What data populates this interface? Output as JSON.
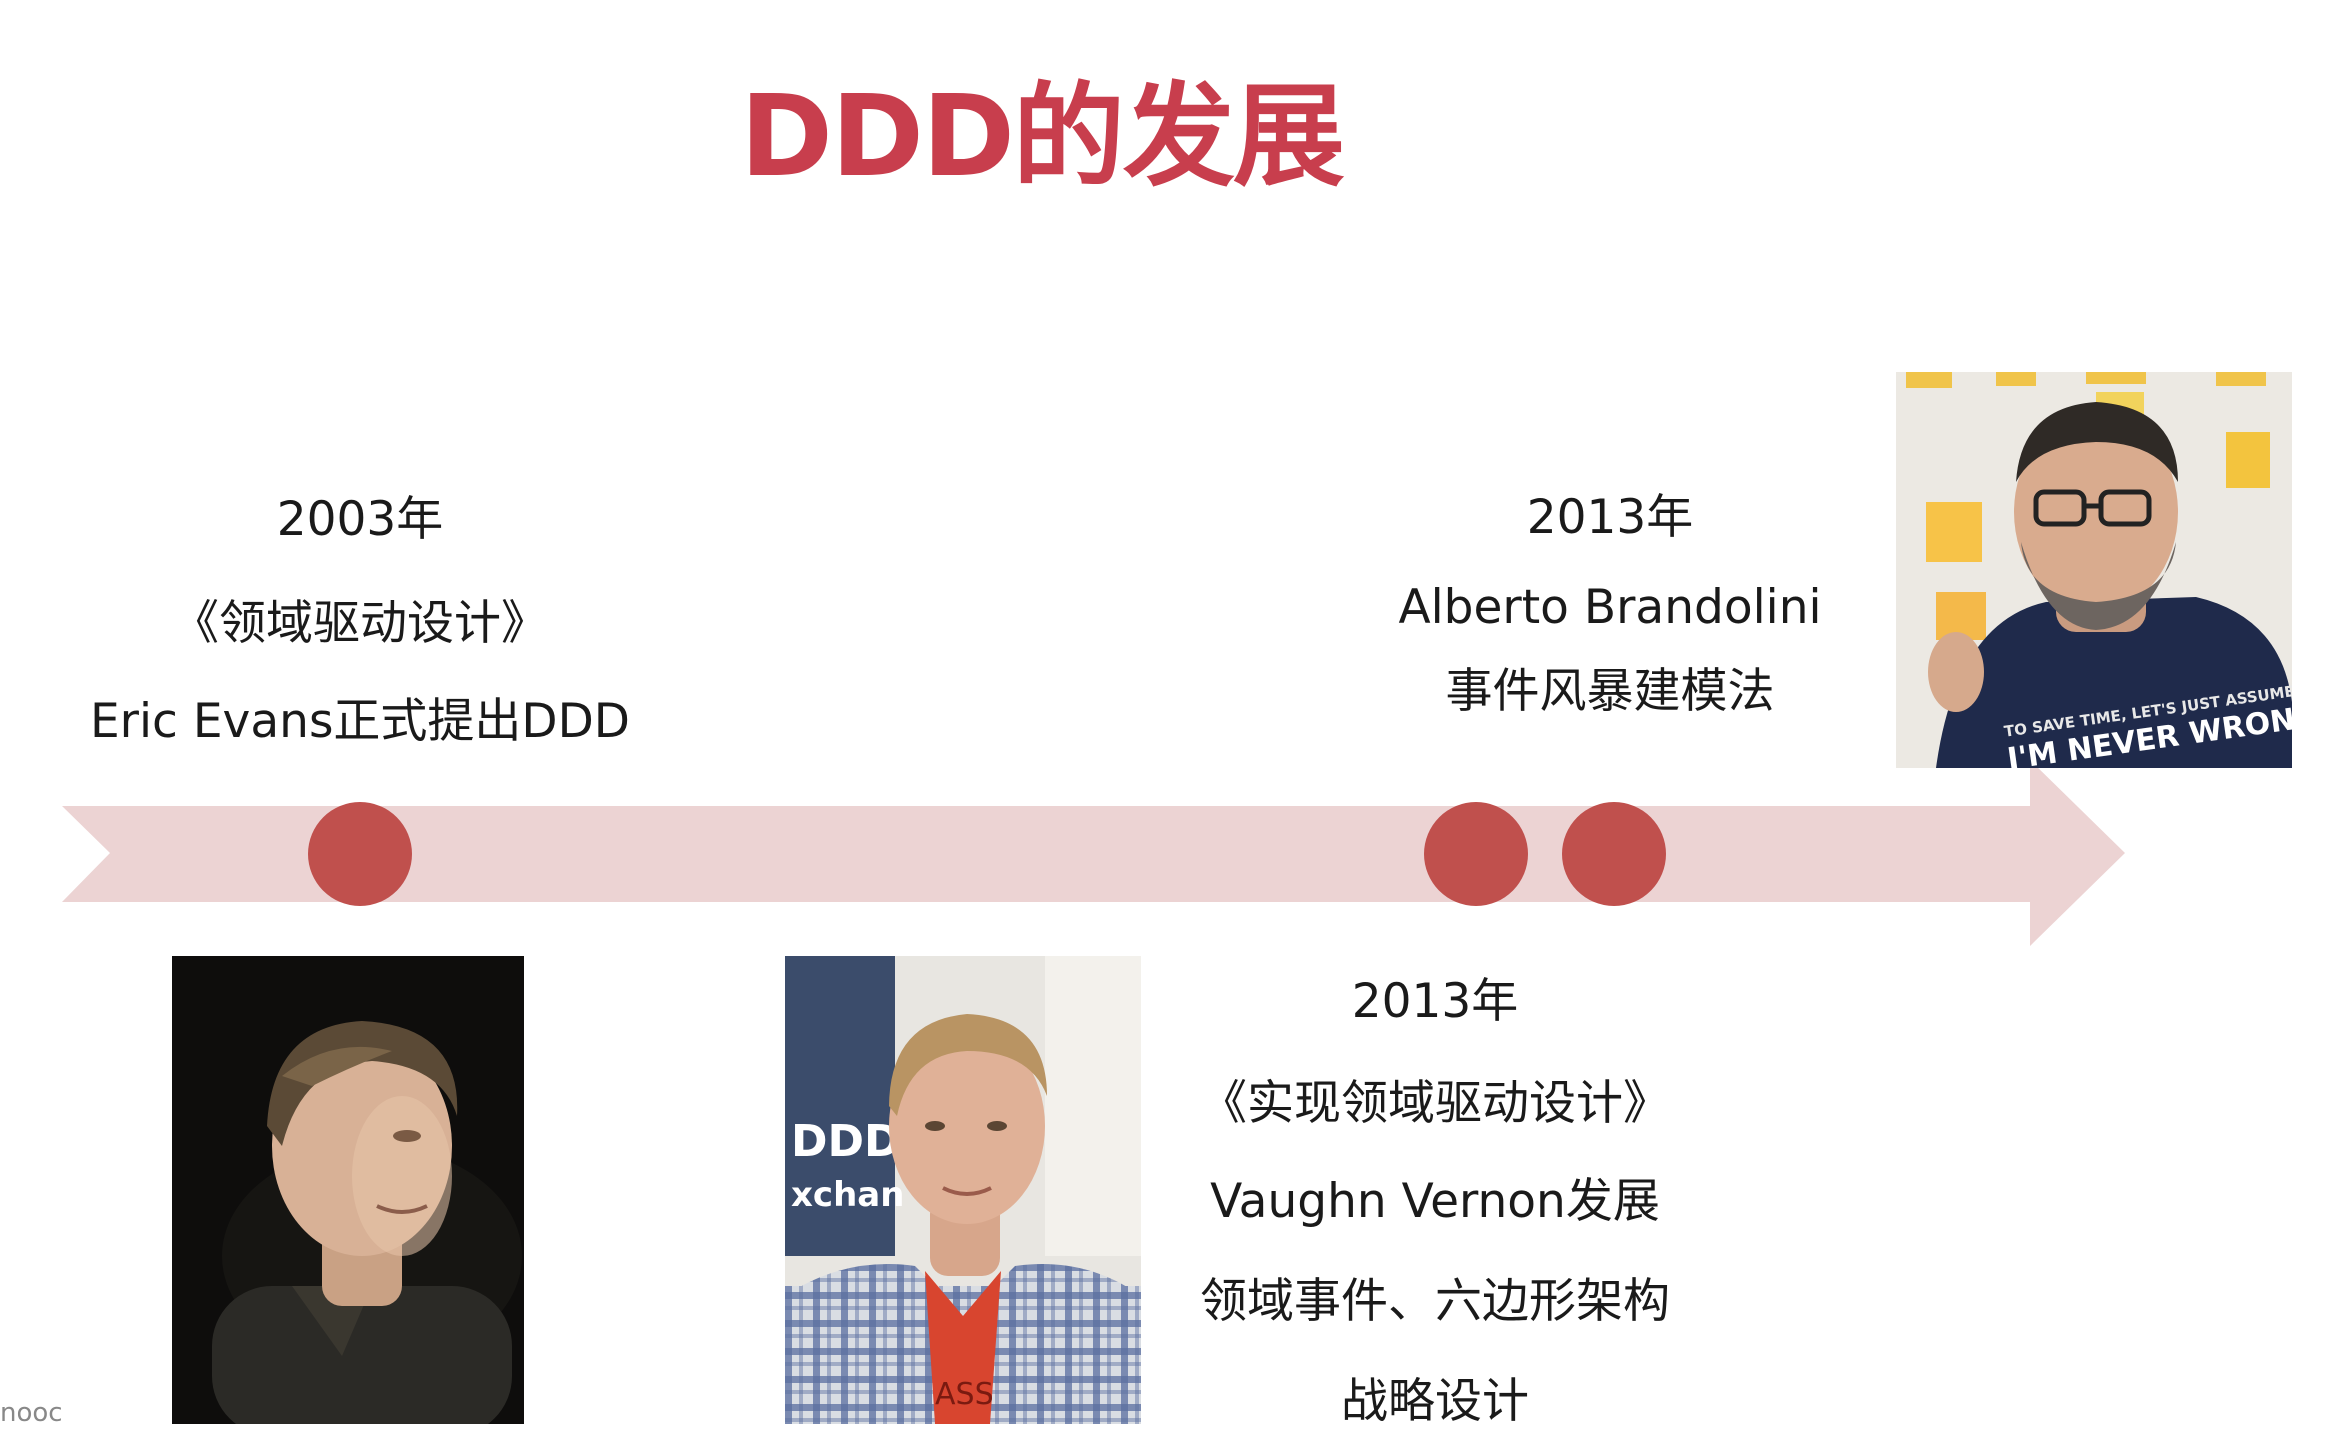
{
  "slide": {
    "title": "DDD的发展",
    "footer": "nooc"
  },
  "events": [
    {
      "year": "2003年",
      "book": "《领域驱动设计》",
      "detail": "Eric Evans正式提出DDD"
    },
    {
      "year": "2013年",
      "person": "Alberto Brandolini",
      "detail": "事件风暴建模法"
    },
    {
      "year": "2013年",
      "book": "《实现领域驱动设计》",
      "person_line": "Vaughn Vernon发展",
      "detail1": "领域事件、六边形架构",
      "detail2": "战略设计"
    }
  ],
  "photos": {
    "brandolini_shirt_line1": "TO SAVE TIME, LET'S JUST ASSUME",
    "brandolini_shirt_line2": "I'M NEVER WRONG",
    "vernon_banner": "DDD Exchange"
  },
  "colors": {
    "title": "#c83e4d",
    "timeline": "#ecd3d3",
    "dot": "#c0504d"
  }
}
